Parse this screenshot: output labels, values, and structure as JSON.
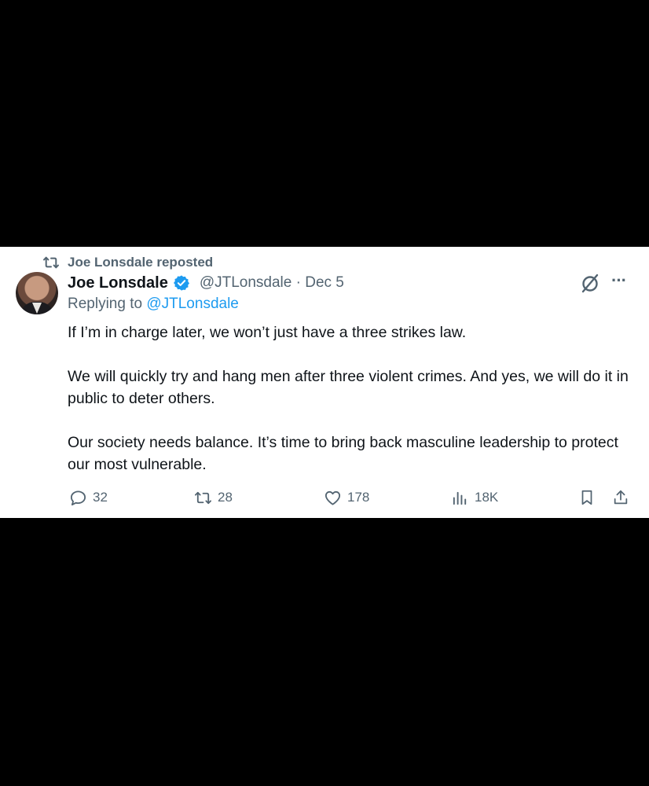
{
  "repost": {
    "label": "Joe Lonsdale reposted",
    "icon": "repost-icon"
  },
  "tweet": {
    "author": {
      "name": "Joe Lonsdale",
      "handle": "@JTLonsdale",
      "date_separator": "·",
      "date": "Dec 5",
      "verified": true
    },
    "reply": {
      "prefix": "Replying to",
      "target": "@JTLonsdale"
    },
    "paragraphs": [
      "If I’m in charge later, we won’t just have a three strikes law.",
      "We will quickly try and hang men after three violent crimes. And yes, we will do it in public to deter others.",
      "Our society needs balance. It’s time to bring back masculine leadership to protect our most vulnerable."
    ],
    "actions": {
      "replies": "32",
      "reposts": "28",
      "likes": "178",
      "views": "18K"
    }
  },
  "colors": {
    "accent": "#1d9bf0",
    "muted": "#536471",
    "text": "#0f1419",
    "background": "#ffffff",
    "frame": "#000000"
  },
  "icons": [
    "repost-icon",
    "verified-badge-icon",
    "grok-icon",
    "more-icon",
    "reply-icon",
    "like-icon",
    "views-icon",
    "bookmark-icon",
    "share-icon"
  ]
}
